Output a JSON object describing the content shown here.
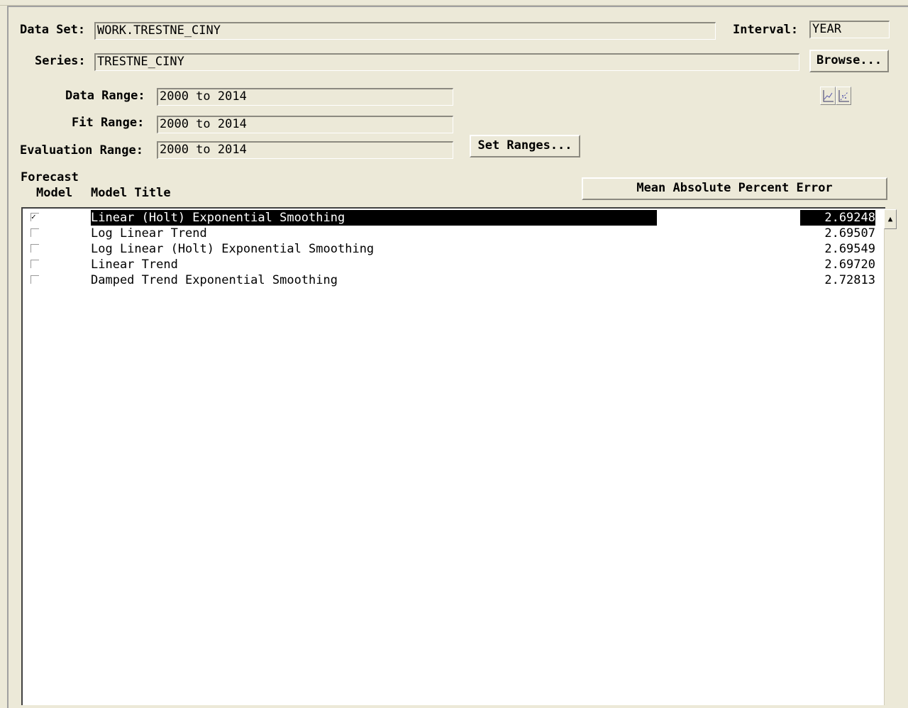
{
  "dataset": {
    "label": "Data Set:",
    "value": "WORK.TRESTNE_CINY"
  },
  "interval": {
    "label": "Interval:",
    "value": "YEAR"
  },
  "series": {
    "label": "Series:",
    "value": "TRESTNE_CINY"
  },
  "browse_label": "Browse...",
  "data_range": {
    "label": "Data Range:",
    "value": "2000 to 2014"
  },
  "fit_range": {
    "label": "Fit Range:",
    "value": "2000 to 2014"
  },
  "eval_range": {
    "label": "Evaluation Range:",
    "value": "2000 to 2014"
  },
  "set_ranges_label": "Set Ranges...",
  "icons": [
    "line-chart-icon",
    "scatter-chart-icon"
  ],
  "columns": {
    "forecast": "Forecast",
    "model": "Model",
    "title": "Model Title",
    "metric": "Mean Absolute Percent Error"
  },
  "models": [
    {
      "title": "Linear (Holt) Exponential Smoothing",
      "mape": "2.69248",
      "checked": true,
      "selected": true
    },
    {
      "title": "Log Linear Trend",
      "mape": "2.69507",
      "checked": false
    },
    {
      "title": "Log Linear (Holt) Exponential Smoothing",
      "mape": "2.69549",
      "checked": false
    },
    {
      "title": "Linear Trend",
      "mape": "2.69720",
      "checked": false
    },
    {
      "title": "Damped Trend Exponential Smoothing",
      "mape": "2.72813",
      "checked": false
    }
  ]
}
